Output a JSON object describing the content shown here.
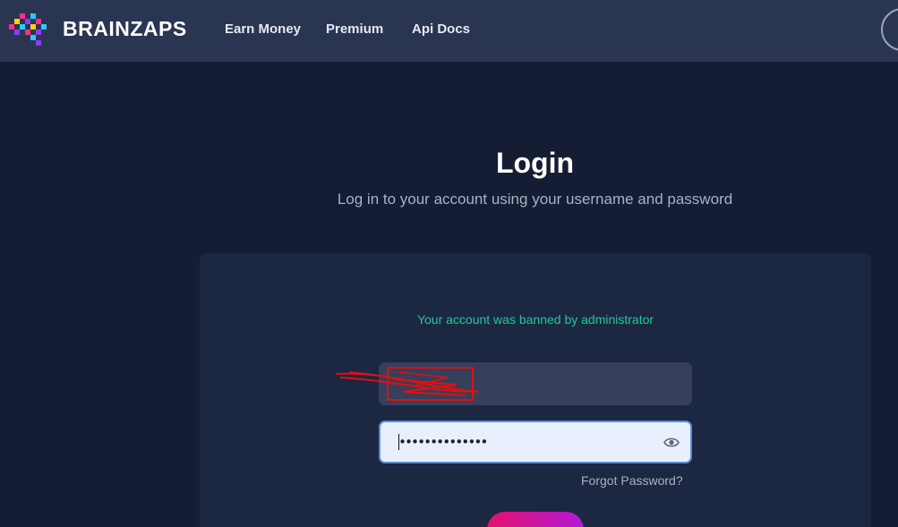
{
  "header": {
    "brand": "BRAINZAPS",
    "nav": [
      "Earn Money",
      "Premium",
      "Api Docs"
    ]
  },
  "login": {
    "title": "Login",
    "subtitle": "Log in to your account using your username and password",
    "alert": "Your account was banned by administrator",
    "username_value": "",
    "password_value": "••••••••••••••",
    "forgot": "Forgot Password?"
  },
  "colors": {
    "background": "#141d33",
    "navbar": "#2a3552",
    "card": "#1c2742",
    "alert": "#20c997",
    "button_gradient_start": "#e6116d",
    "button_gradient_end": "#b11ad8"
  },
  "icons": {
    "logo": "pixel-brain-logo",
    "password_toggle": "eye-icon"
  }
}
